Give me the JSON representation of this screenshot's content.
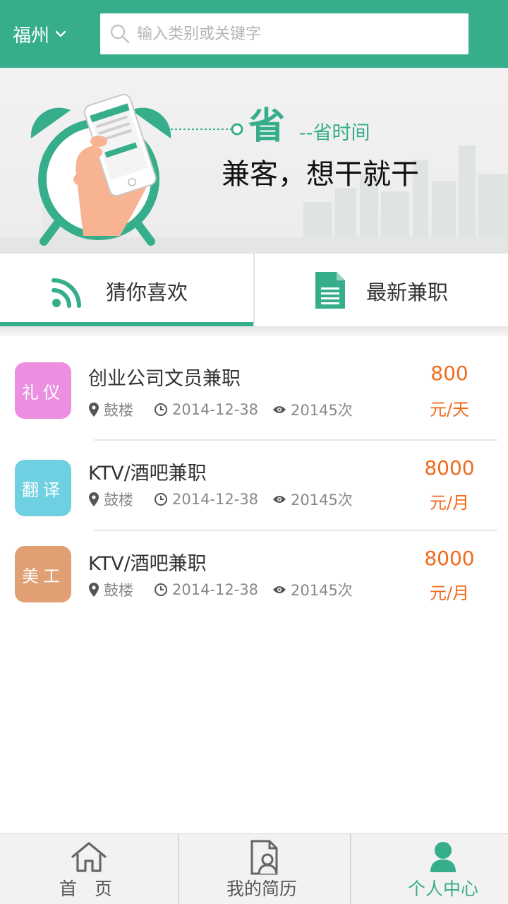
{
  "header": {
    "city": "福州",
    "search_placeholder": "输入类别或关键字"
  },
  "banner": {
    "big_char": "省",
    "subtitle": "--省时间",
    "slogan": "兼客，想干就干"
  },
  "tabs": [
    {
      "label": "猜你喜欢",
      "icon": "rss-icon",
      "active": true
    },
    {
      "label": "最新兼职",
      "icon": "document-icon",
      "active": false
    }
  ],
  "jobs": [
    {
      "badge": "礼仪",
      "badge_color": "#ec8fe0",
      "title": "创业公司文员兼职",
      "location": "鼓楼",
      "date": "2014-12-38",
      "views": "20145次",
      "price": "800",
      "unit": "元/天"
    },
    {
      "badge": "翻译",
      "badge_color": "#6fd0e2",
      "title": "KTV/酒吧兼职",
      "location": "鼓楼",
      "date": "2014-12-38",
      "views": "20145次",
      "price": "8000",
      "unit": "元/月"
    },
    {
      "badge": "美工",
      "badge_color": "#e0a074",
      "title": "KTV/酒吧兼职",
      "location": "鼓楼",
      "date": "2014-12-38",
      "views": "20145次",
      "price": "8000",
      "unit": "元/月"
    }
  ],
  "bottom_nav": [
    {
      "label": "首　页",
      "icon": "home-icon",
      "active": false
    },
    {
      "label": "我的简历",
      "icon": "resume-icon",
      "active": false
    },
    {
      "label": "个人中心",
      "icon": "user-icon",
      "active": true
    }
  ],
  "colors": {
    "brand": "#36ae8b",
    "price": "#f06a1c"
  }
}
